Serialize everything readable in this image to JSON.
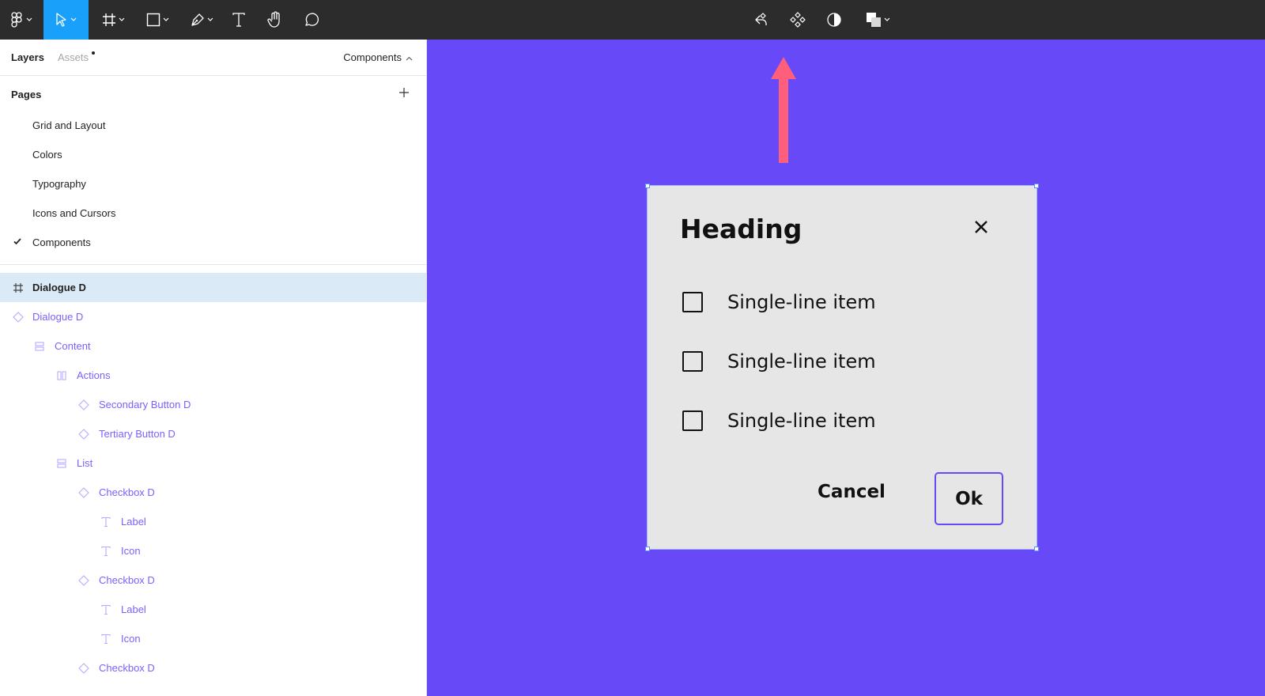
{
  "toolbar": {
    "left_tools": [
      "figma-menu-icon",
      "move-tool-icon",
      "frame-tool-icon",
      "shape-tool-icon",
      "pen-tool-icon",
      "text-tool-icon",
      "hand-tool-icon",
      "comment-tool-icon"
    ],
    "center_tools": [
      "create-component-icon",
      "component-icon",
      "mask-icon",
      "boolean-icon"
    ],
    "active_color": "#18a0fb"
  },
  "sidebar": {
    "tabs": {
      "layers": "Layers",
      "assets": "Assets"
    },
    "current_page": "Components",
    "pages_title": "Pages",
    "pages": [
      {
        "label": "Grid and Layout",
        "checked": false
      },
      {
        "label": "Colors",
        "checked": false
      },
      {
        "label": "Typography",
        "checked": false
      },
      {
        "label": "Icons and Cursors",
        "checked": false
      },
      {
        "label": "Components",
        "checked": true
      }
    ],
    "layers": [
      {
        "label": "Dialogue D",
        "icon": "frame-icon",
        "selected": true
      },
      {
        "label": "Dialogue D",
        "icon": "component-instance-icon",
        "selected": false
      },
      {
        "label": "Content",
        "icon": "vertical-autolayout-icon",
        "selected": false
      },
      {
        "label": "Actions",
        "icon": "horizontal-autolayout-icon",
        "selected": false
      },
      {
        "label": "Secondary Button D",
        "icon": "component-instance-icon",
        "selected": false
      },
      {
        "label": "Tertiary Button D",
        "icon": "component-instance-icon",
        "selected": false
      },
      {
        "label": "List",
        "icon": "vertical-autolayout-icon",
        "selected": false
      },
      {
        "label": "Checkbox D",
        "icon": "component-instance-icon",
        "selected": false
      },
      {
        "label": "Label",
        "icon": "text-layer-icon",
        "selected": false
      },
      {
        "label": "Icon",
        "icon": "text-layer-icon",
        "selected": false
      },
      {
        "label": "Checkbox D",
        "icon": "component-instance-icon",
        "selected": false
      },
      {
        "label": "Label",
        "icon": "text-layer-icon",
        "selected": false
      },
      {
        "label": "Icon",
        "icon": "text-layer-icon",
        "selected": false
      },
      {
        "label": "Checkbox D",
        "icon": "component-instance-icon",
        "selected": false
      }
    ]
  },
  "canvas": {
    "background": "#6849f8",
    "arrow_color": "#ff5f7a",
    "dialog": {
      "heading": "Heading",
      "items": [
        "Single-line item",
        "Single-line item",
        "Single-line item"
      ],
      "cancel_label": "Cancel",
      "ok_label": "Ok"
    }
  }
}
